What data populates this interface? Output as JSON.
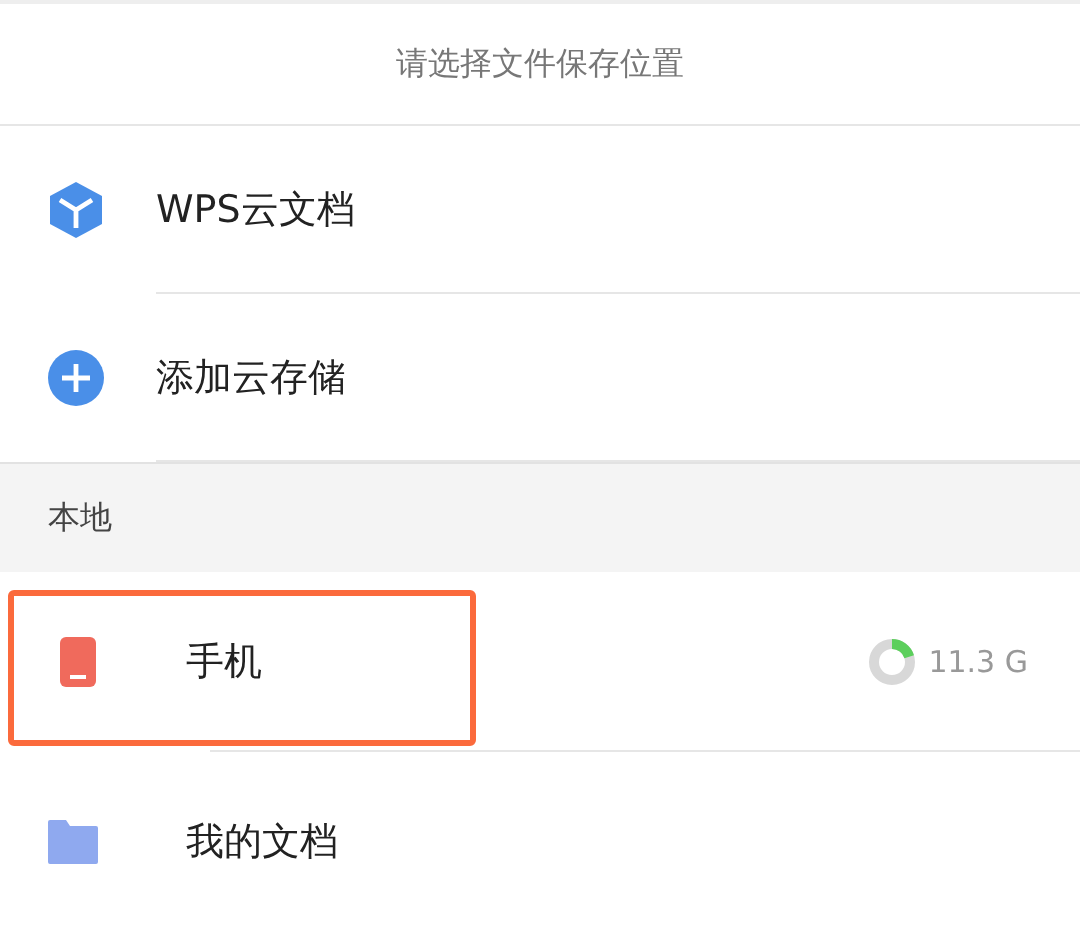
{
  "header": {
    "title": "请选择文件保存位置"
  },
  "cloud_items": [
    {
      "kind": "cube",
      "label": "WPS云文档"
    },
    {
      "kind": "plus",
      "label": "添加云存储"
    }
  ],
  "section": {
    "title": "本地"
  },
  "local_items": [
    {
      "kind": "phone",
      "label": "手机",
      "highlighted": true,
      "storage": {
        "level": 0.2,
        "reading": "11.3 G"
      }
    },
    {
      "kind": "folder",
      "label": "我的文档",
      "highlighted": false
    }
  ]
}
